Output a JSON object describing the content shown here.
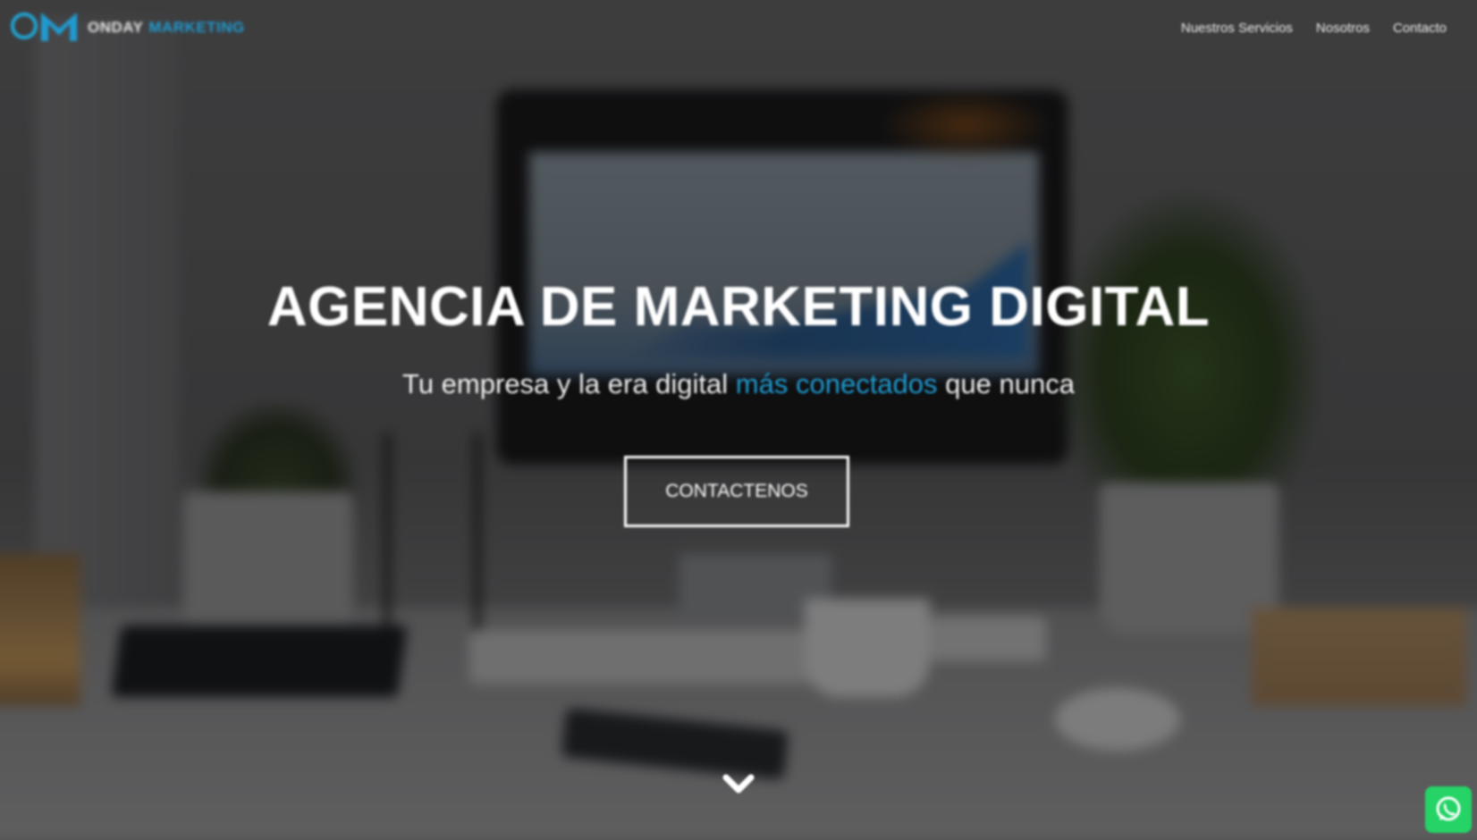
{
  "header": {
    "brand_primary": "ONDAY",
    "brand_secondary": "MARKETING",
    "logo_icon": "onday-marketing-logo",
    "nav": [
      {
        "label": "Nuestros Servicios"
      },
      {
        "label": "Nosotros"
      },
      {
        "label": "Contacto"
      }
    ]
  },
  "hero": {
    "title": "AGENCIA DE MARKETING DIGITAL",
    "subtitle_before": "Tu empresa y la era digital ",
    "subtitle_accent": "más conectados",
    "subtitle_after": " que nunca",
    "cta_label": "CONTACTENOS",
    "scroll_icon": "chevron-down-icon"
  },
  "floating": {
    "whatsapp_icon": "whatsapp-icon"
  },
  "colors": {
    "accent": "#1f9bd1",
    "whatsapp": "#25d366",
    "overlay": "rgba(0,0,0,0.42)"
  }
}
